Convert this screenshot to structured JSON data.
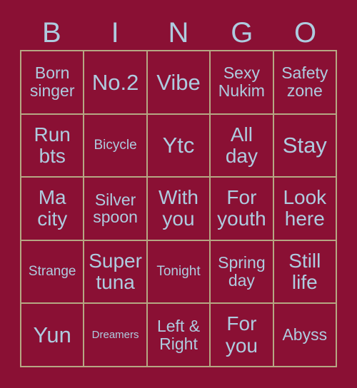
{
  "card": {
    "title": "BINGO",
    "background_color": "#8a1034",
    "text_color": "#aecbdf",
    "grid_line_color": "#b6a783"
  },
  "header": {
    "letters": [
      "B",
      "I",
      "N",
      "G",
      "O"
    ]
  },
  "grid": {
    "rows": 5,
    "columns": 5,
    "cells": [
      [
        {
          "text": "Born singer",
          "size": "md"
        },
        {
          "text": "No.2",
          "size": "xl"
        },
        {
          "text": "Vibe",
          "size": "xl"
        },
        {
          "text": "Sexy Nukim",
          "size": "md"
        },
        {
          "text": "Safety zone",
          "size": "md"
        }
      ],
      [
        {
          "text": "Run bts",
          "size": "lg"
        },
        {
          "text": "Bicycle",
          "size": "sm"
        },
        {
          "text": "Ytc",
          "size": "xl"
        },
        {
          "text": "All day",
          "size": "lg"
        },
        {
          "text": "Stay",
          "size": "xl"
        }
      ],
      [
        {
          "text": "Ma city",
          "size": "lg"
        },
        {
          "text": "Silver spoon",
          "size": "md"
        },
        {
          "text": "With you",
          "size": "lg"
        },
        {
          "text": "For youth",
          "size": "lg"
        },
        {
          "text": "Look here",
          "size": "lg"
        }
      ],
      [
        {
          "text": "Strange",
          "size": "sm"
        },
        {
          "text": "Super tuna",
          "size": "lg"
        },
        {
          "text": "Tonight",
          "size": "sm"
        },
        {
          "text": "Spring day",
          "size": "md"
        },
        {
          "text": "Still life",
          "size": "lg"
        }
      ],
      [
        {
          "text": "Yun",
          "size": "xl"
        },
        {
          "text": "Dreamers",
          "size": "xs"
        },
        {
          "text": "Left & Right",
          "size": "md"
        },
        {
          "text": "For you",
          "size": "lg"
        },
        {
          "text": "Abyss",
          "size": "md"
        }
      ]
    ]
  }
}
